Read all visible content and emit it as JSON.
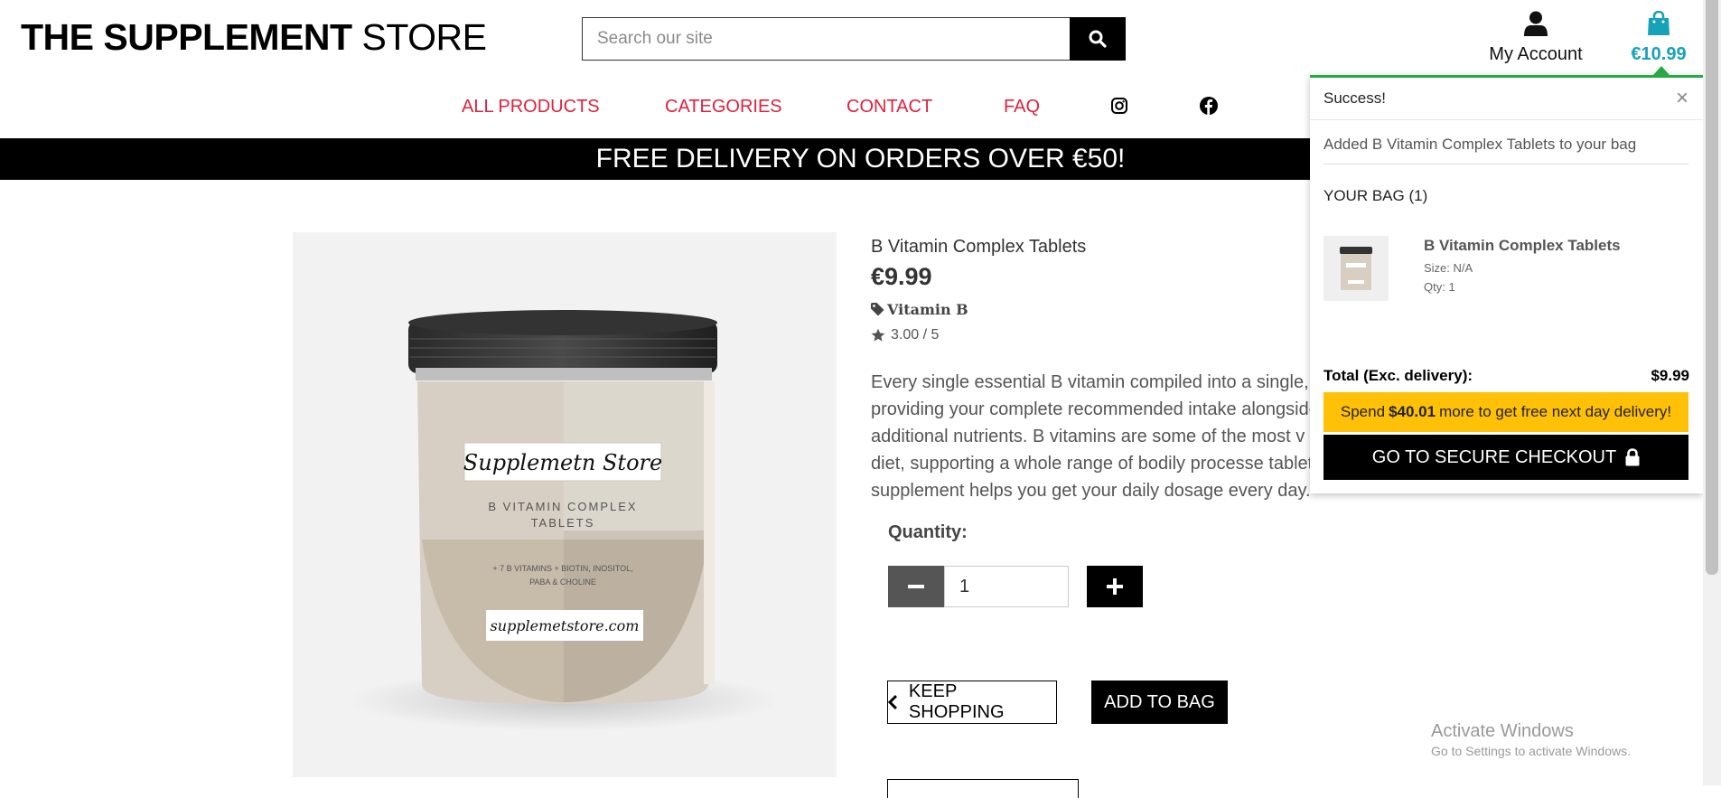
{
  "header": {
    "logo_bold": "THE SUPPLEMENT",
    "logo_light": "STORE",
    "search_placeholder": "Search our site",
    "account_label": "My Account",
    "bag_total": "€10.99"
  },
  "nav": {
    "all_products": "ALL PRODUCTS",
    "categories": "CATEGORIES",
    "contact": "CONTACT",
    "faq": "FAQ"
  },
  "banner": "FREE DELIVERY ON ORDERS OVER €50!",
  "product": {
    "name": "B Vitamin Complex Tablets",
    "price": "€9.99",
    "category": "Vitamin B",
    "rating": "3.00 / 5",
    "description": "Every single essential B vitamin compiled into a single, ea providing your complete recommended intake alongside of additional nutrients. B vitamins are some of the most v in your diet, supporting a whole range of bodily processe tablet supplement helps you get your daily dosage every day.",
    "image_labels": {
      "brand": "Supplemetn Store",
      "line1": "B VITAMIN COMPLEX",
      "line2": "TABLETS",
      "small1": "+ 7 B VITAMINS + BIOTIN, INOSITOL,",
      "small2": "PABA & CHOLINE",
      "url": "supplemetstore.com"
    },
    "quantity_label": "Quantity:",
    "quantity_value": "1",
    "keep_shopping": "KEEP SHOPPING",
    "add_to_bag": "ADD TO BAG"
  },
  "toast": {
    "title": "Success!",
    "close": "×",
    "message": "Added B Vitamin Complex Tablets to your bag",
    "bag_heading": "YOUR BAG (1)",
    "item_name": "B Vitamin Complex Tablets",
    "item_size": "Size: N/A",
    "item_qty": "Qty: 1",
    "total_label": "Total (Exc. delivery):",
    "total_value": "$9.99",
    "spend_pre": "Spend",
    "spend_amount": "$40.01",
    "spend_post": "more to get free next day delivery!",
    "checkout": "GO TO SECURE CHECKOUT"
  },
  "watermark": {
    "line1": "Activate Windows",
    "line2": "Go to Settings to activate Windows."
  },
  "colors": {
    "nav": "#e0203e",
    "bag_accent": "#17a2b8",
    "toast_border": "#28a745",
    "spend_banner": "#ffc107"
  },
  "icons": [
    "search-icon",
    "user-icon",
    "shopping-bag-icon",
    "instagram-icon",
    "facebook-icon",
    "tag-icon",
    "star-icon",
    "minus-icon",
    "plus-icon",
    "chevron-left-icon",
    "lock-icon",
    "close-icon"
  ]
}
